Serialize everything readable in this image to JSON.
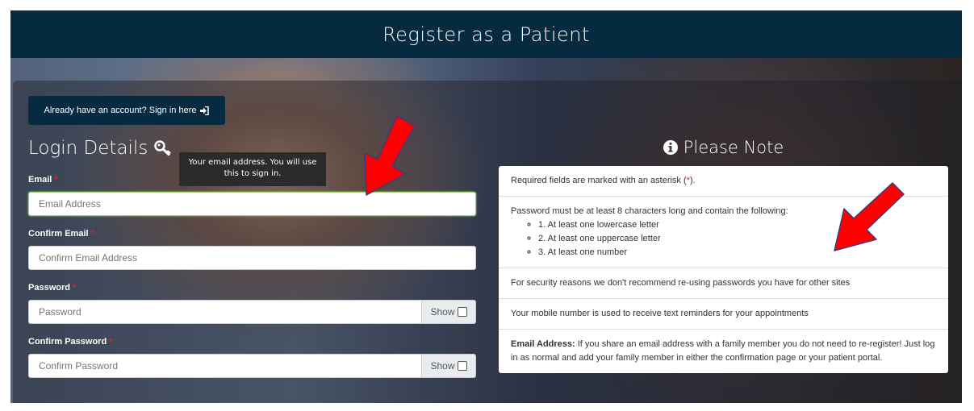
{
  "header": {
    "title": "Register as a Patient"
  },
  "signin": {
    "label": "Already have an account? Sign in here"
  },
  "login": {
    "title": "Login Details",
    "tooltip": "Your email address. You will use this to sign in.",
    "fields": {
      "email": {
        "label": "Email",
        "placeholder": "Email Address"
      },
      "confirm_email": {
        "label": "Confirm Email",
        "placeholder": "Confirm Email Address"
      },
      "password": {
        "label": "Password",
        "placeholder": "Password",
        "toggle": "Show"
      },
      "confirm_password": {
        "label": "Confirm Password",
        "placeholder": "Confirm Password",
        "toggle": "Show"
      }
    },
    "required_marker": "*"
  },
  "note": {
    "title": "Please Note",
    "required_prefix": "Required fields are marked with an asterisk (",
    "required_marker": "*",
    "required_suffix": ").",
    "password_intro": "Password must be at least 8 characters long and contain the following:",
    "password_rules": [
      "1. At least one lowercase letter",
      "2. At least one uppercase letter",
      "3. At least one number"
    ],
    "security": "For security reasons we don't recommend re-using passwords you have for other sites",
    "mobile": "Your mobile number is used to receive text reminders for your appointments",
    "email_bold": "Email Address:",
    "email_text": " If you share an email address with a family member you do not need to re-register! Just log in as normal and add your family member in either the confirmation page or your patient portal."
  },
  "colors": {
    "header_bg": "#062b40",
    "required": "#e02020",
    "arrow": "#ff0000",
    "focus": "#9bd26c"
  }
}
